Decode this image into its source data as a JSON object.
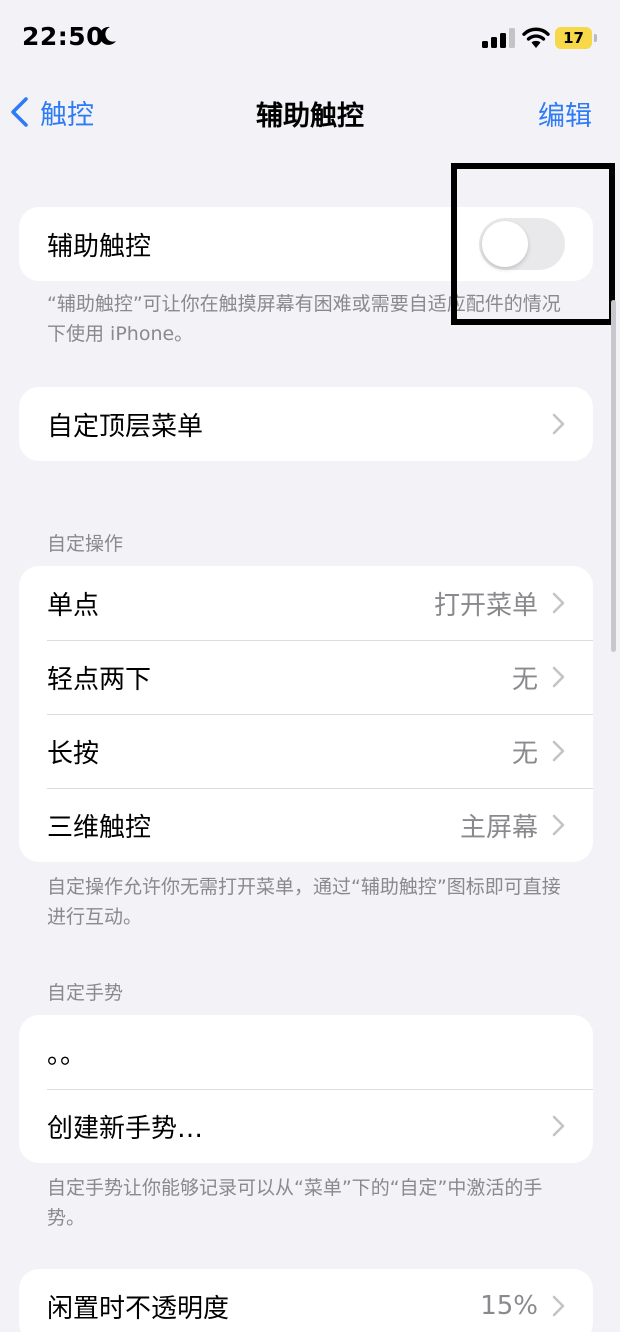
{
  "status_bar": {
    "time": "22:50",
    "battery": "17"
  },
  "nav": {
    "back_label": "触控",
    "title": "辅助触控",
    "edit_label": "编辑"
  },
  "assistive_touch": {
    "label": "辅助触控",
    "enabled": false,
    "note": "“辅助触控”可让你在触摸屏幕有困难或需要自适应配件的情况下使用 iPhone。"
  },
  "top_menu": {
    "label": "自定顶层菜单"
  },
  "custom_actions": {
    "header": "自定操作",
    "rows": [
      {
        "label": "单点",
        "value": "打开菜单"
      },
      {
        "label": "轻点两下",
        "value": "无"
      },
      {
        "label": "长按",
        "value": "无"
      },
      {
        "label": "三维触控",
        "value": "主屏幕"
      }
    ],
    "note": "自定操作允许你无需打开菜单，通过“辅助触控”图标即可直接进行互动。"
  },
  "custom_gestures": {
    "header": "自定手势",
    "gesture_item": "。。",
    "create_label": "创建新手势…",
    "note": "自定手势让你能够记录可以从“菜单”下的“自定”中激活的手势。"
  },
  "idle_opacity": {
    "label": "闲置时不透明度",
    "value": "15%"
  },
  "colors": {
    "accent": "#2f7bf6",
    "background": "#f2f2f7",
    "secondary_text": "#8a8a8e",
    "battery": "#f7d84a"
  }
}
